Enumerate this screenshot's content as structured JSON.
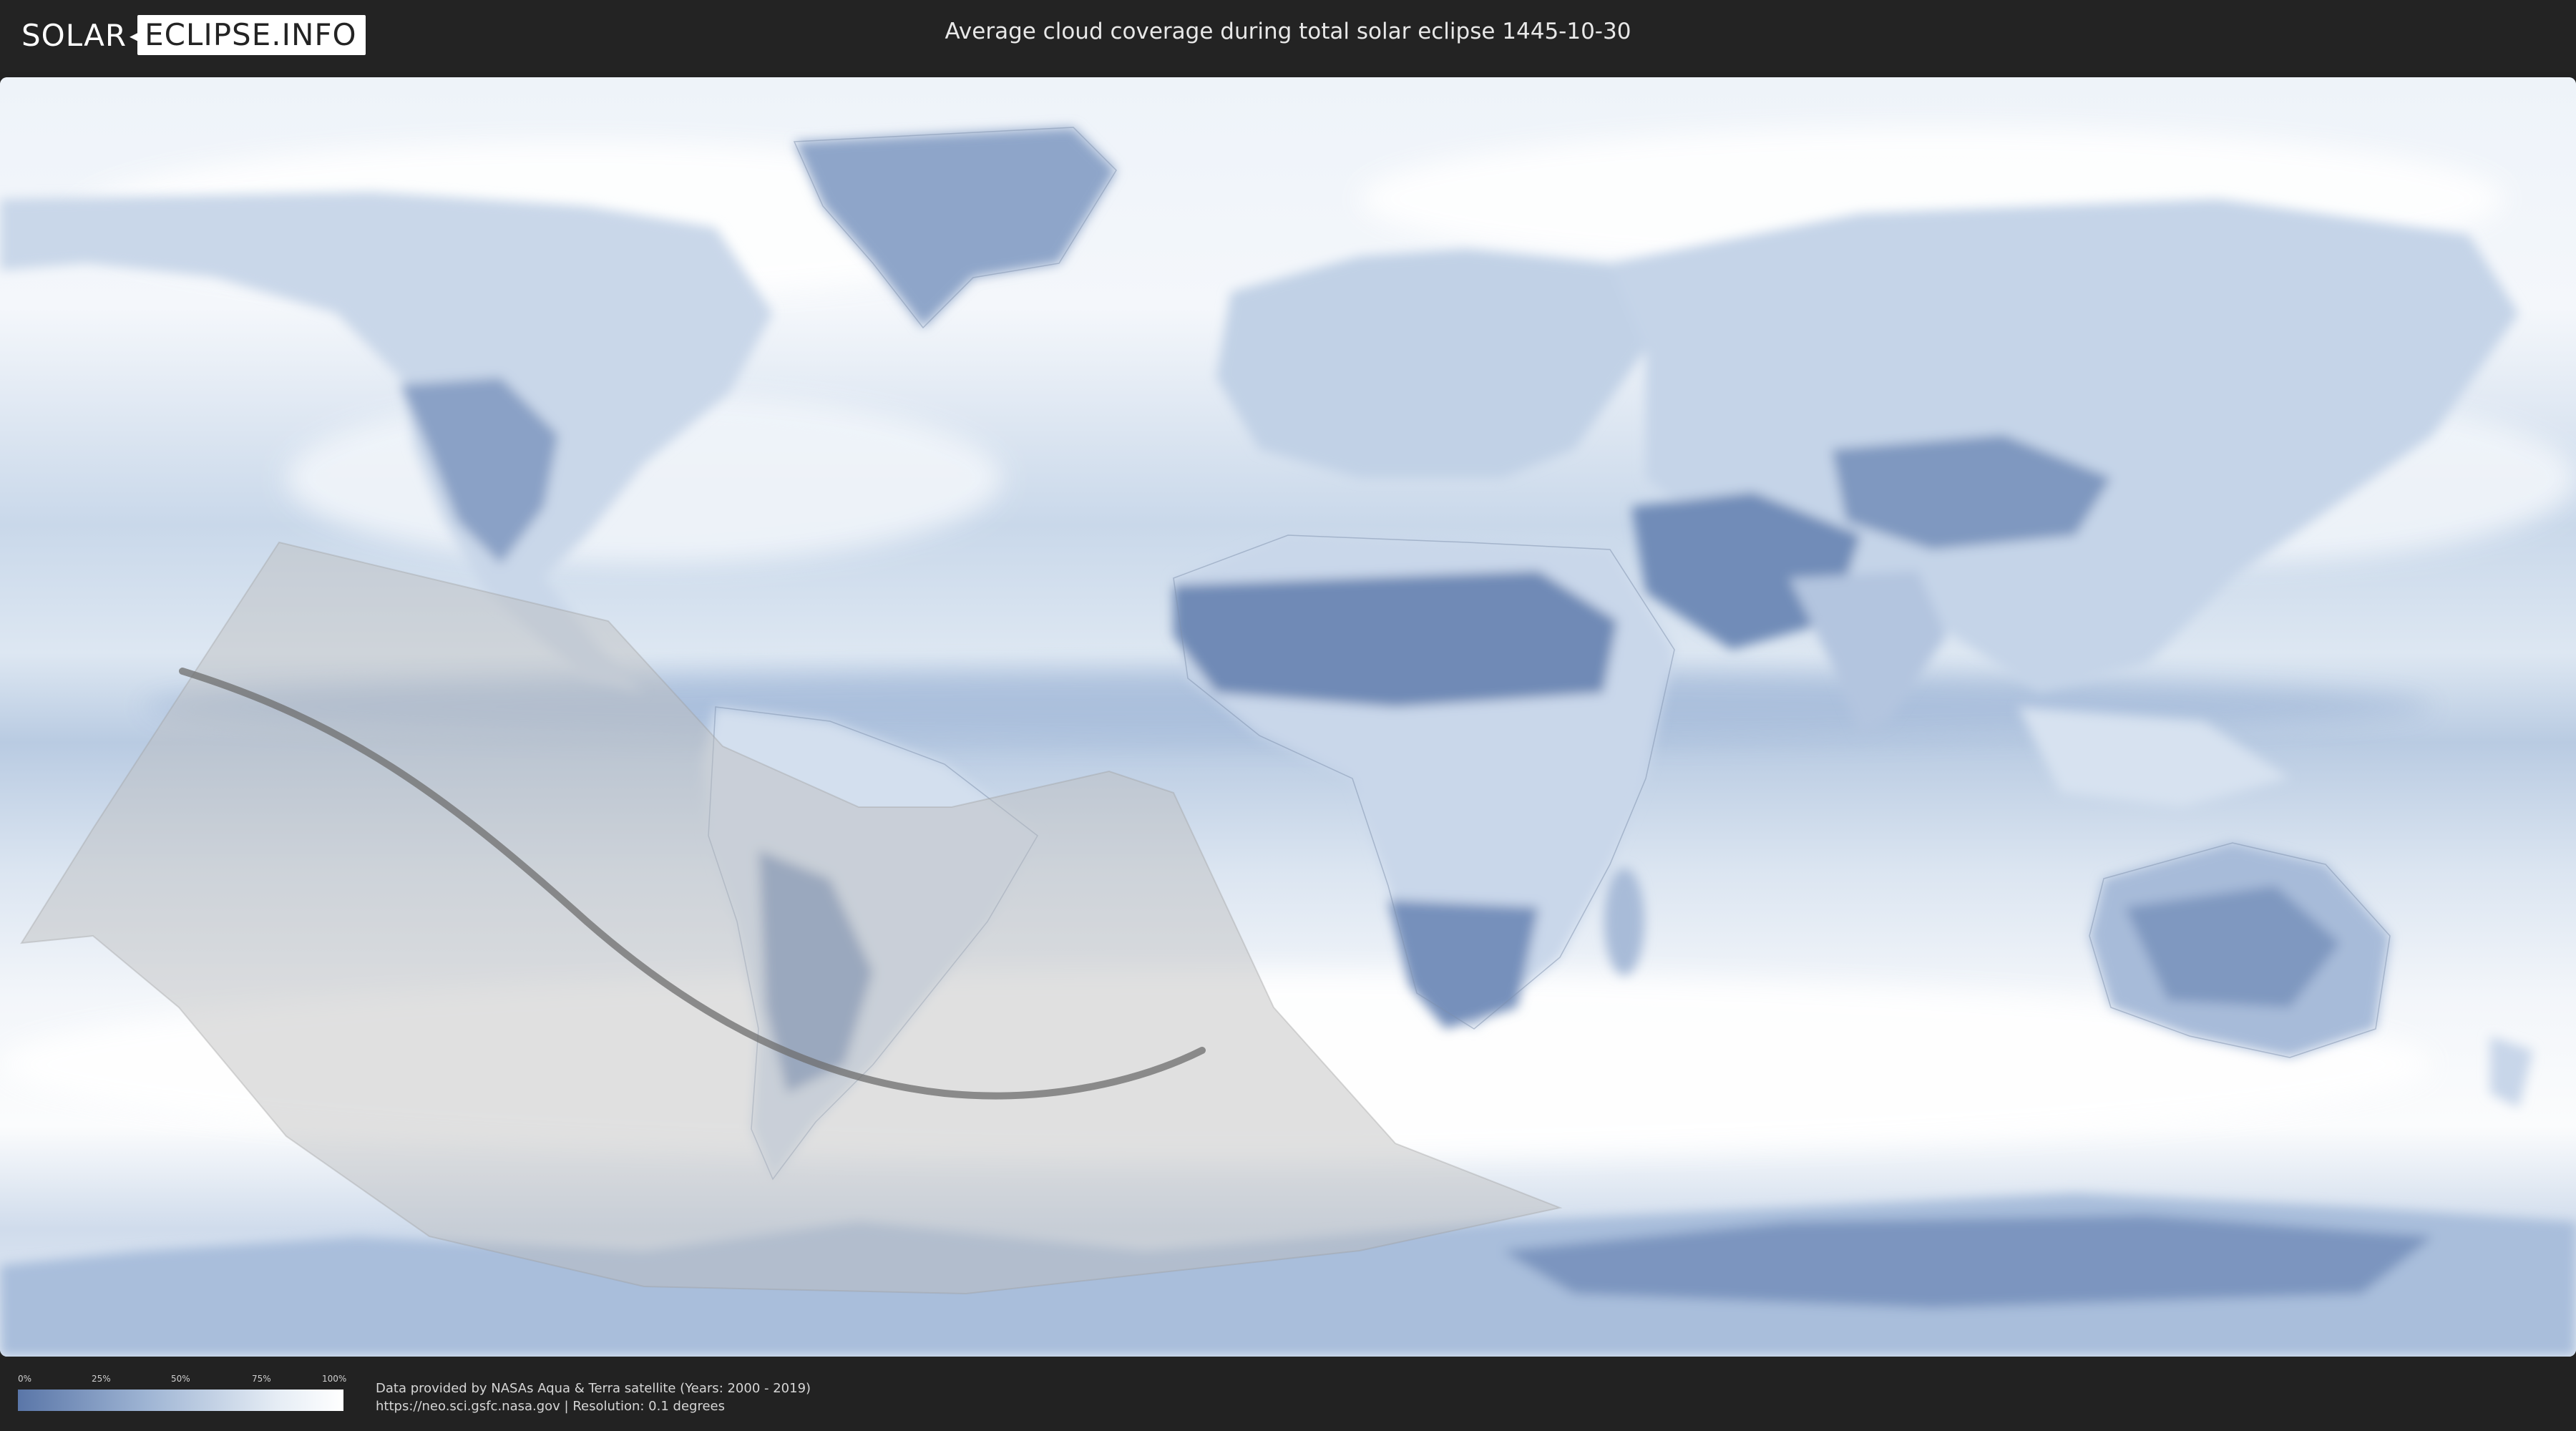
{
  "header": {
    "logo_left": "SOLAR",
    "logo_right": "ECLIPSE.INFO",
    "title": "Average cloud coverage during total solar eclipse 1445-10-30"
  },
  "map": {
    "layer": "average cloud coverage",
    "colors": {
      "ocean_clear": "#c6d6ea",
      "cloudy": "#ffffff",
      "clear_land": "#6f8ab6",
      "eclipse_zone": "#bcbcbc",
      "central_line": "#6e6e6e"
    }
  },
  "legend": {
    "ticks": [
      "0%",
      "25%",
      "50%",
      "75%",
      "100%"
    ],
    "gradient_from": "#5a76a8",
    "gradient_to": "#ffffff"
  },
  "credits": {
    "line1": "Data provided by NASAs Aqua & Terra satellite (Years: 2000 - 2019)",
    "line2": "https://neo.sci.gsfc.nasa.gov | Resolution: 0.1 degrees"
  }
}
